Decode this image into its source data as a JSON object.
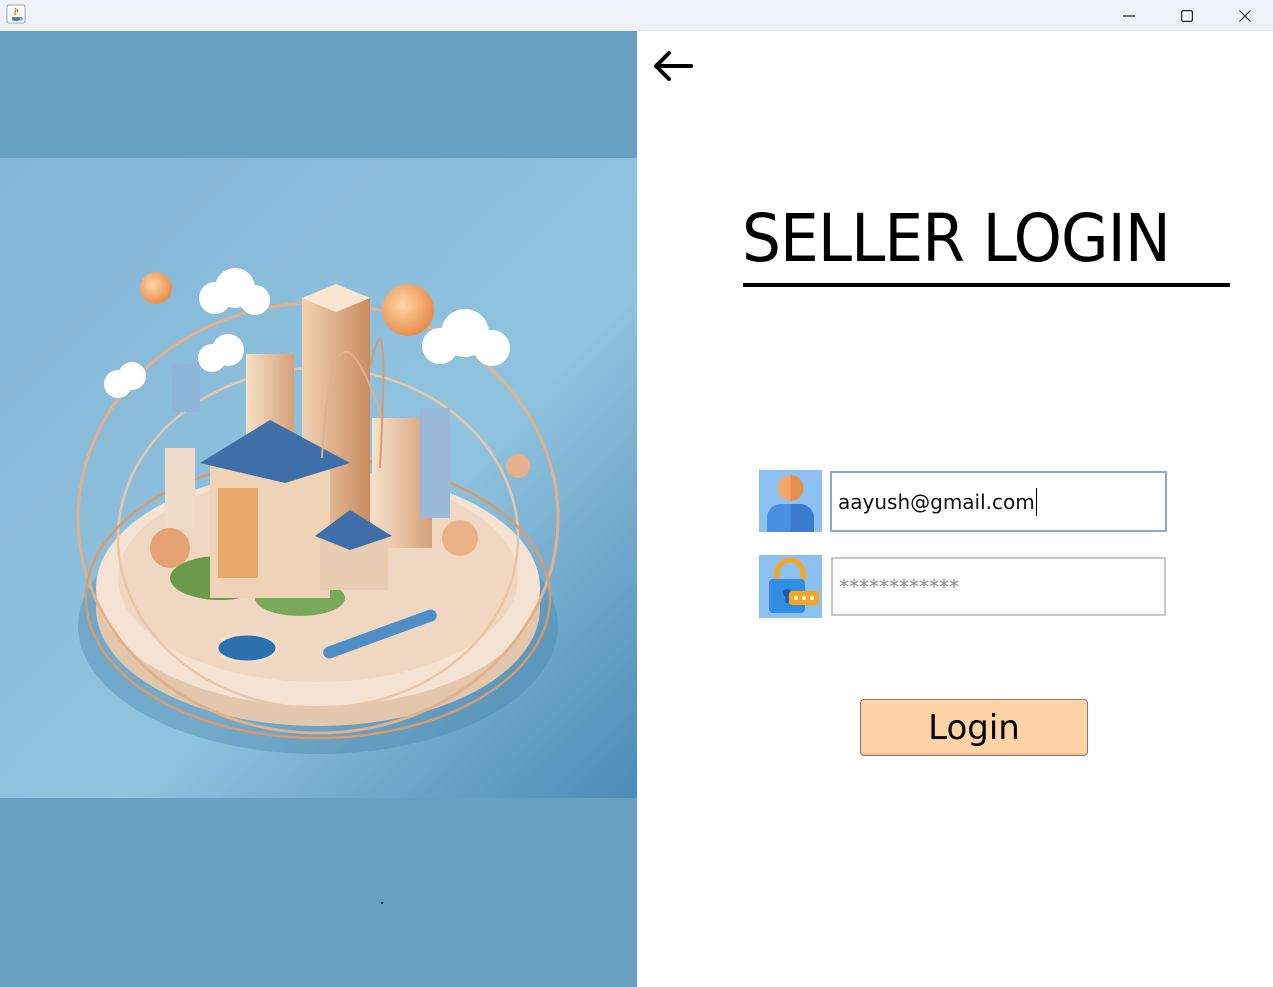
{
  "window": {
    "controls": [
      "minimize",
      "maximize",
      "close"
    ]
  },
  "page": {
    "heading": "SELLER LOGIN",
    "email_value": "aayush@gmail.com",
    "password_mask": "************",
    "login_label": "Login"
  },
  "colors": {
    "left_panel_bg": "#68a0c4",
    "button_bg": "#ffd3a6",
    "email_border": "#8aa9d6"
  },
  "icons": [
    "java-app-icon",
    "minimize-icon",
    "maximize-icon",
    "close-icon",
    "back-arrow-icon",
    "user-icon",
    "lock-icon"
  ]
}
